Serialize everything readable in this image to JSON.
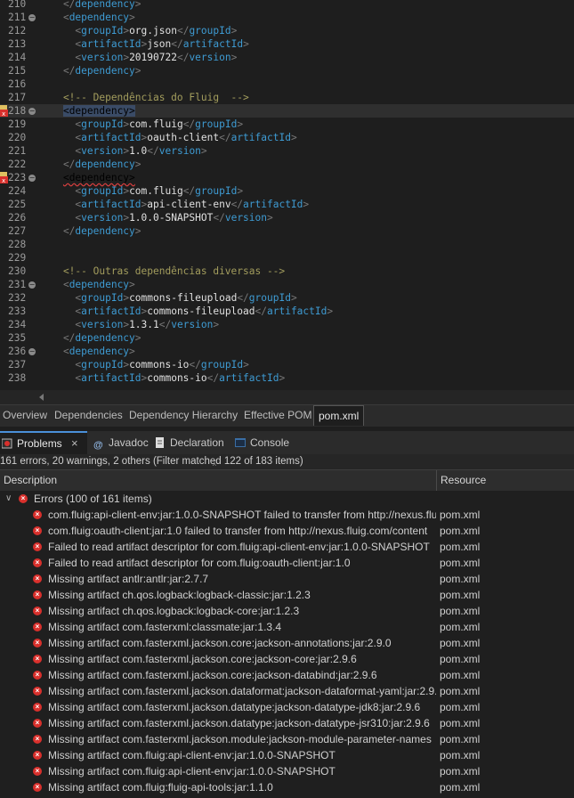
{
  "editor": {
    "lines": [
      {
        "num": "210",
        "fold": false,
        "err": false,
        "current": false,
        "parts": [
          [
            "br",
            "    </"
          ],
          [
            "tag",
            "dependency"
          ],
          [
            "br",
            ">"
          ]
        ]
      },
      {
        "num": "211",
        "fold": true,
        "err": false,
        "current": false,
        "parts": [
          [
            "br",
            "    <"
          ],
          [
            "tag",
            "dependency"
          ],
          [
            "br",
            ">"
          ]
        ]
      },
      {
        "num": "212",
        "fold": false,
        "err": false,
        "current": false,
        "parts": [
          [
            "br",
            "      <"
          ],
          [
            "tag",
            "groupId"
          ],
          [
            "br",
            ">"
          ],
          [
            "txt",
            "org.json"
          ],
          [
            "br",
            "</"
          ],
          [
            "tag",
            "groupId"
          ],
          [
            "br",
            ">"
          ]
        ]
      },
      {
        "num": "213",
        "fold": false,
        "err": false,
        "current": false,
        "parts": [
          [
            "br",
            "      <"
          ],
          [
            "tag",
            "artifactId"
          ],
          [
            "br",
            ">"
          ],
          [
            "txt",
            "json"
          ],
          [
            "br",
            "</"
          ],
          [
            "tag",
            "artifactId"
          ],
          [
            "br",
            ">"
          ]
        ]
      },
      {
        "num": "214",
        "fold": false,
        "err": false,
        "current": false,
        "parts": [
          [
            "br",
            "      <"
          ],
          [
            "tag",
            "version"
          ],
          [
            "br",
            ">"
          ],
          [
            "txt",
            "20190722"
          ],
          [
            "br",
            "</"
          ],
          [
            "tag",
            "version"
          ],
          [
            "br",
            ">"
          ]
        ]
      },
      {
        "num": "215",
        "fold": false,
        "err": false,
        "current": false,
        "parts": [
          [
            "br",
            "    </"
          ],
          [
            "tag",
            "dependency"
          ],
          [
            "br",
            ">"
          ]
        ]
      },
      {
        "num": "216",
        "fold": false,
        "err": false,
        "current": false,
        "parts": []
      },
      {
        "num": "217",
        "fold": false,
        "err": false,
        "current": false,
        "parts": [
          [
            "cmt",
            "    <!-- Dependências do Fluig  -->"
          ]
        ]
      },
      {
        "num": "218",
        "fold": true,
        "err": true,
        "current": true,
        "parts": [
          [
            "br",
            "    "
          ],
          [
            "hl",
            "<dependency>"
          ]
        ]
      },
      {
        "num": "219",
        "fold": false,
        "err": false,
        "current": false,
        "parts": [
          [
            "br",
            "      <"
          ],
          [
            "tag",
            "groupId"
          ],
          [
            "br",
            ">"
          ],
          [
            "txt",
            "com.fluig"
          ],
          [
            "br",
            "</"
          ],
          [
            "tag",
            "groupId"
          ],
          [
            "br",
            ">"
          ]
        ]
      },
      {
        "num": "220",
        "fold": false,
        "err": false,
        "current": false,
        "parts": [
          [
            "br",
            "      <"
          ],
          [
            "tag",
            "artifactId"
          ],
          [
            "br",
            ">"
          ],
          [
            "txt",
            "oauth-client"
          ],
          [
            "br",
            "</"
          ],
          [
            "tag",
            "artifactId"
          ],
          [
            "br",
            ">"
          ]
        ]
      },
      {
        "num": "221",
        "fold": false,
        "err": false,
        "current": false,
        "parts": [
          [
            "br",
            "      <"
          ],
          [
            "tag",
            "version"
          ],
          [
            "br",
            ">"
          ],
          [
            "txt",
            "1.0"
          ],
          [
            "br",
            "</"
          ],
          [
            "tag",
            "version"
          ],
          [
            "br",
            ">"
          ]
        ]
      },
      {
        "num": "222",
        "fold": false,
        "err": false,
        "current": false,
        "parts": [
          [
            "br",
            "    </"
          ],
          [
            "tag",
            "dependency"
          ],
          [
            "br",
            ">"
          ]
        ]
      },
      {
        "num": "223",
        "fold": true,
        "err": true,
        "current": false,
        "parts": [
          [
            "br",
            "    "
          ],
          [
            "squig",
            "<dependency>"
          ]
        ]
      },
      {
        "num": "224",
        "fold": false,
        "err": false,
        "current": false,
        "parts": [
          [
            "br",
            "      <"
          ],
          [
            "tag",
            "groupId"
          ],
          [
            "br",
            ">"
          ],
          [
            "txt",
            "com.fluig"
          ],
          [
            "br",
            "</"
          ],
          [
            "tag",
            "groupId"
          ],
          [
            "br",
            ">"
          ]
        ]
      },
      {
        "num": "225",
        "fold": false,
        "err": false,
        "current": false,
        "parts": [
          [
            "br",
            "      <"
          ],
          [
            "tag",
            "artifactId"
          ],
          [
            "br",
            ">"
          ],
          [
            "txt",
            "api-client-env"
          ],
          [
            "br",
            "</"
          ],
          [
            "tag",
            "artifactId"
          ],
          [
            "br",
            ">"
          ]
        ]
      },
      {
        "num": "226",
        "fold": false,
        "err": false,
        "current": false,
        "parts": [
          [
            "br",
            "      <"
          ],
          [
            "tag",
            "version"
          ],
          [
            "br",
            ">"
          ],
          [
            "txt",
            "1.0.0-SNAPSHOT"
          ],
          [
            "br",
            "</"
          ],
          [
            "tag",
            "version"
          ],
          [
            "br",
            ">"
          ]
        ]
      },
      {
        "num": "227",
        "fold": false,
        "err": false,
        "current": false,
        "parts": [
          [
            "br",
            "    </"
          ],
          [
            "tag",
            "dependency"
          ],
          [
            "br",
            ">"
          ]
        ]
      },
      {
        "num": "228",
        "fold": false,
        "err": false,
        "current": false,
        "parts": []
      },
      {
        "num": "229",
        "fold": false,
        "err": false,
        "current": false,
        "parts": []
      },
      {
        "num": "230",
        "fold": false,
        "err": false,
        "current": false,
        "parts": [
          [
            "cmt",
            "    <!-- Outras dependências diversas -->"
          ]
        ]
      },
      {
        "num": "231",
        "fold": true,
        "err": false,
        "current": false,
        "parts": [
          [
            "br",
            "    <"
          ],
          [
            "tag",
            "dependency"
          ],
          [
            "br",
            ">"
          ]
        ]
      },
      {
        "num": "232",
        "fold": false,
        "err": false,
        "current": false,
        "parts": [
          [
            "br",
            "      <"
          ],
          [
            "tag",
            "groupId"
          ],
          [
            "br",
            ">"
          ],
          [
            "txt",
            "commons-fileupload"
          ],
          [
            "br",
            "</"
          ],
          [
            "tag",
            "groupId"
          ],
          [
            "br",
            ">"
          ]
        ]
      },
      {
        "num": "233",
        "fold": false,
        "err": false,
        "current": false,
        "parts": [
          [
            "br",
            "      <"
          ],
          [
            "tag",
            "artifactId"
          ],
          [
            "br",
            ">"
          ],
          [
            "txt",
            "commons-fileupload"
          ],
          [
            "br",
            "</"
          ],
          [
            "tag",
            "artifactId"
          ],
          [
            "br",
            ">"
          ]
        ]
      },
      {
        "num": "234",
        "fold": false,
        "err": false,
        "current": false,
        "parts": [
          [
            "br",
            "      <"
          ],
          [
            "tag",
            "version"
          ],
          [
            "br",
            ">"
          ],
          [
            "txt",
            "1.3.1"
          ],
          [
            "br",
            "</"
          ],
          [
            "tag",
            "version"
          ],
          [
            "br",
            ">"
          ]
        ]
      },
      {
        "num": "235",
        "fold": false,
        "err": false,
        "current": false,
        "parts": [
          [
            "br",
            "    </"
          ],
          [
            "tag",
            "dependency"
          ],
          [
            "br",
            ">"
          ]
        ]
      },
      {
        "num": "236",
        "fold": true,
        "err": false,
        "current": false,
        "parts": [
          [
            "br",
            "    <"
          ],
          [
            "tag",
            "dependency"
          ],
          [
            "br",
            ">"
          ]
        ]
      },
      {
        "num": "237",
        "fold": false,
        "err": false,
        "current": false,
        "parts": [
          [
            "br",
            "      <"
          ],
          [
            "tag",
            "groupId"
          ],
          [
            "br",
            ">"
          ],
          [
            "txt",
            "commons-io"
          ],
          [
            "br",
            "</"
          ],
          [
            "tag",
            "groupId"
          ],
          [
            "br",
            ">"
          ]
        ]
      },
      {
        "num": "238",
        "fold": false,
        "err": false,
        "current": false,
        "parts": [
          [
            "br",
            "      <"
          ],
          [
            "tag",
            "artifactId"
          ],
          [
            "br",
            ">"
          ],
          [
            "txt",
            "commons-io"
          ],
          [
            "br",
            "</"
          ],
          [
            "tag",
            "artifactId"
          ],
          [
            "br",
            ">"
          ]
        ]
      }
    ]
  },
  "pom_tabs": [
    {
      "label": "Overview",
      "active": false
    },
    {
      "label": "Dependencies",
      "active": false
    },
    {
      "label": "Dependency Hierarchy",
      "active": false
    },
    {
      "label": "Effective POM",
      "active": false
    },
    {
      "label": "pom.xml",
      "active": true
    }
  ],
  "view_tabs": {
    "problems": "Problems",
    "javadoc": "Javadoc",
    "declaration": "Declaration",
    "console": "Console"
  },
  "problems": {
    "summary": "161 errors, 20 warnings, 2 others (Filter matched 122 of 183 items)",
    "col_description": "Description",
    "col_resource": "Resource",
    "group_label": "Errors (100 of 161 items)",
    "rows": [
      {
        "desc": "com.fluig:api-client-env:jar:1.0.0-SNAPSHOT failed to transfer from http://nexus.fluig.com/content",
        "res": "pom.xml"
      },
      {
        "desc": "com.fluig:oauth-client:jar:1.0 failed to transfer from http://nexus.fluig.com/content",
        "res": "pom.xml"
      },
      {
        "desc": "Failed to read artifact descriptor for com.fluig:api-client-env:jar:1.0.0-SNAPSHOT",
        "res": "pom.xml"
      },
      {
        "desc": "Failed to read artifact descriptor for com.fluig:oauth-client:jar:1.0",
        "res": "pom.xml"
      },
      {
        "desc": "Missing artifact antlr:antlr:jar:2.7.7",
        "res": "pom.xml"
      },
      {
        "desc": "Missing artifact ch.qos.logback:logback-classic:jar:1.2.3",
        "res": "pom.xml"
      },
      {
        "desc": "Missing artifact ch.qos.logback:logback-core:jar:1.2.3",
        "res": "pom.xml"
      },
      {
        "desc": "Missing artifact com.fasterxml:classmate:jar:1.3.4",
        "res": "pom.xml"
      },
      {
        "desc": "Missing artifact com.fasterxml.jackson.core:jackson-annotations:jar:2.9.0",
        "res": "pom.xml"
      },
      {
        "desc": "Missing artifact com.fasterxml.jackson.core:jackson-core:jar:2.9.6",
        "res": "pom.xml"
      },
      {
        "desc": "Missing artifact com.fasterxml.jackson.core:jackson-databind:jar:2.9.6",
        "res": "pom.xml"
      },
      {
        "desc": "Missing artifact com.fasterxml.jackson.dataformat:jackson-dataformat-yaml:jar:2.9.6",
        "res": "pom.xml"
      },
      {
        "desc": "Missing artifact com.fasterxml.jackson.datatype:jackson-datatype-jdk8:jar:2.9.6",
        "res": "pom.xml"
      },
      {
        "desc": "Missing artifact com.fasterxml.jackson.datatype:jackson-datatype-jsr310:jar:2.9.6",
        "res": "pom.xml"
      },
      {
        "desc": "Missing artifact com.fasterxml.jackson.module:jackson-module-parameter-names",
        "res": "pom.xml"
      },
      {
        "desc": "Missing artifact com.fluig:api-client-env:jar:1.0.0-SNAPSHOT",
        "res": "pom.xml"
      },
      {
        "desc": "Missing artifact com.fluig:api-client-env:jar:1.0.0-SNAPSHOT",
        "res": "pom.xml"
      },
      {
        "desc": "Missing artifact com.fluig:fluig-api-tools:jar:1.1.0",
        "res": "pom.xml"
      }
    ]
  },
  "colors": {
    "accent": "#4a90d9",
    "error": "#d9302c",
    "tag": "#3e9bd3",
    "comment": "#a39d5d"
  }
}
